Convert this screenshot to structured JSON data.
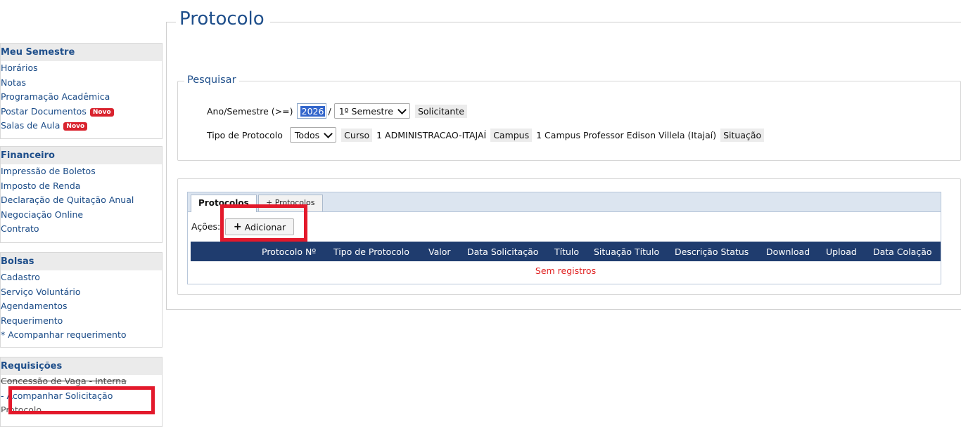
{
  "sidebar": {
    "sections": [
      {
        "title": "Meu Semestre",
        "items": [
          {
            "label": "Horários"
          },
          {
            "label": "Notas"
          },
          {
            "label": "Programação Acadêmica"
          },
          {
            "label": "Postar Documentos",
            "badge": "Novo"
          },
          {
            "label": "Salas de Aula",
            "badge": "Novo"
          }
        ]
      },
      {
        "title": "Financeiro",
        "items": [
          {
            "label": "Impressão de Boletos"
          },
          {
            "label": "Imposto de Renda"
          },
          {
            "label": "Declaração de Quitação Anual"
          },
          {
            "label": "Negociação Online"
          },
          {
            "label": "Contrato"
          }
        ]
      },
      {
        "title": "Bolsas",
        "items": [
          {
            "label": "Cadastro"
          },
          {
            "label": "Serviço Voluntário"
          },
          {
            "label": "Agendamentos"
          },
          {
            "label": "Requerimento"
          },
          {
            "label": "* Acompanhar requerimento"
          }
        ]
      },
      {
        "title": "Requisições",
        "items": [
          {
            "label": "Concessão de Vaga - Interna"
          },
          {
            "label": "- Acompanhar Solicitação"
          },
          {
            "label": "Protocolo"
          }
        ]
      }
    ]
  },
  "page": {
    "title": "Protocolo"
  },
  "search": {
    "legend": "Pesquisar",
    "ano_label": "Ano/Semestre (>=)",
    "ano_value": "2026",
    "slash": "/",
    "semestre_value": "1º Semestre",
    "solicitante_label": "Solicitante",
    "tipo_label": "Tipo de Protocolo",
    "tipo_value": "Todos",
    "curso_label": "Curso",
    "curso_value": "1 ADMINISTRACAO-ITAJAÍ",
    "campus_label": "Campus",
    "campus_value": "1 Campus Professor Edison Villela (Itajaí)",
    "situacao_label": "Situação"
  },
  "protocols": {
    "tabs": [
      {
        "label": "Protocolos",
        "active": true
      },
      {
        "label": "+ Protocolos",
        "active": false
      }
    ],
    "acoes_label": "Ações:",
    "add_button": "Adicionar",
    "columns": [
      "Protocolo Nº",
      "Tipo de Protocolo",
      "Valor",
      "Data Solicitação",
      "Título",
      "Situação Título",
      "Descrição Status",
      "Download",
      "Upload",
      "Data Colação"
    ],
    "empty_message": "Sem registros"
  },
  "colors": {
    "accent_blue": "#1f4f8b",
    "table_header": "#1f3c6e",
    "highlight_red": "#e3192b",
    "badge_red": "#d9232e",
    "empty_text": "#e02020"
  }
}
